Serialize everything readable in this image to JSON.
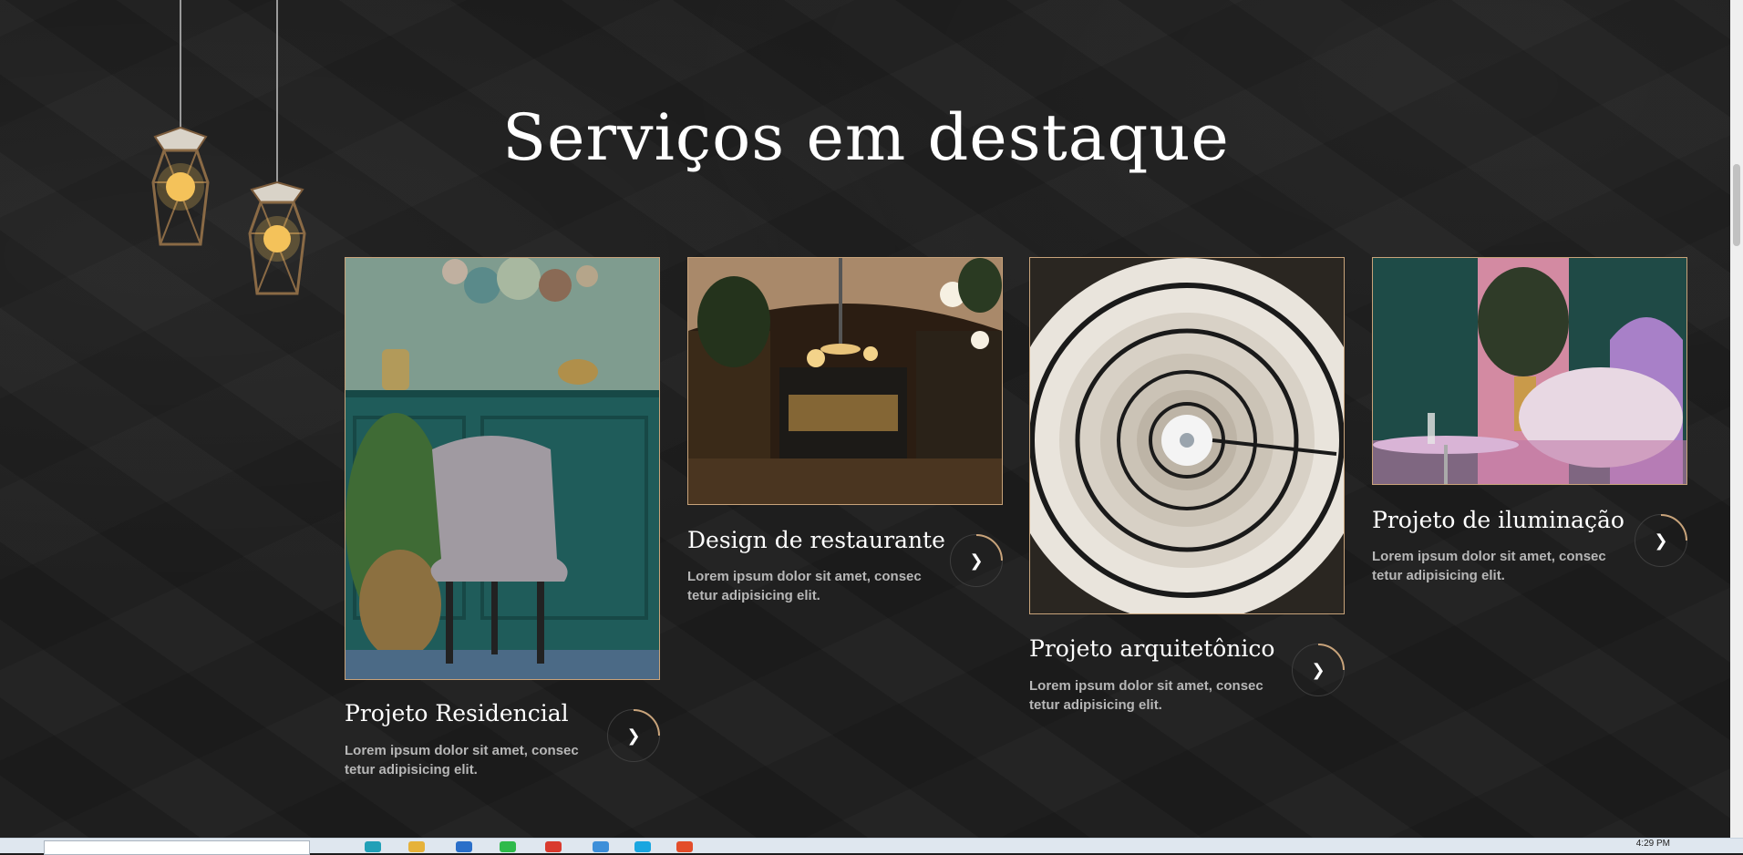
{
  "section": {
    "title": "Serviços em destaque"
  },
  "services": [
    {
      "title": "Projeto Residencial",
      "description": "Lorem ipsum dolor sit amet, consec tetur adipisicing elit."
    },
    {
      "title": "Design de restaurante",
      "description": "Lorem ipsum dolor sit amet, consec tetur adipisicing elit."
    },
    {
      "title": "Projeto arquitetônico",
      "description": "Lorem ipsum dolor sit amet, consec tetur adipisicing elit."
    },
    {
      "title": "Projeto de iluminação",
      "description": "Lorem ipsum dolor sit amet, consec tetur adipisicing elit."
    }
  ],
  "taskbar": {
    "clock": "4:29 PM"
  },
  "colors": {
    "background": "#1d1d1d",
    "accent": "#c8a37a",
    "text": "#ffffff",
    "muted": "#b7b7b7"
  },
  "icons": {
    "card_arrow": "chevron-right-icon",
    "decoration": "pendant-lamp-icon"
  }
}
